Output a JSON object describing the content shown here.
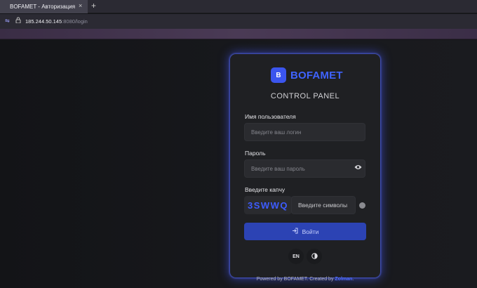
{
  "browser": {
    "tab_title": "BOFAMET - Авторизация",
    "tab_close": "×",
    "new_tab": "+",
    "url_host": "185.244.50.145",
    "url_rest": ":8080/login"
  },
  "login": {
    "logo_letter": "B",
    "brand": "BOFAMET",
    "subtitle": "CONTROL PANEL",
    "username_label": "Имя пользователя",
    "username_placeholder": "Введите ваш логин",
    "password_label": "Пароль",
    "password_placeholder": "Введите ваш пароль",
    "captcha_label": "Введите капчу",
    "captcha_code": "3SWWQ",
    "captcha_placeholder": "Введите символы",
    "submit_label": "Войти",
    "lang": "EN"
  },
  "footer": {
    "prefix": "Powered by BOFAMET. Created by ",
    "author": "Zolman",
    "suffix": "."
  },
  "colors": {
    "accent": "#3f63ff",
    "button": "#2c43b4",
    "card_bg": "#1f2023",
    "page_bg": "#141518"
  }
}
